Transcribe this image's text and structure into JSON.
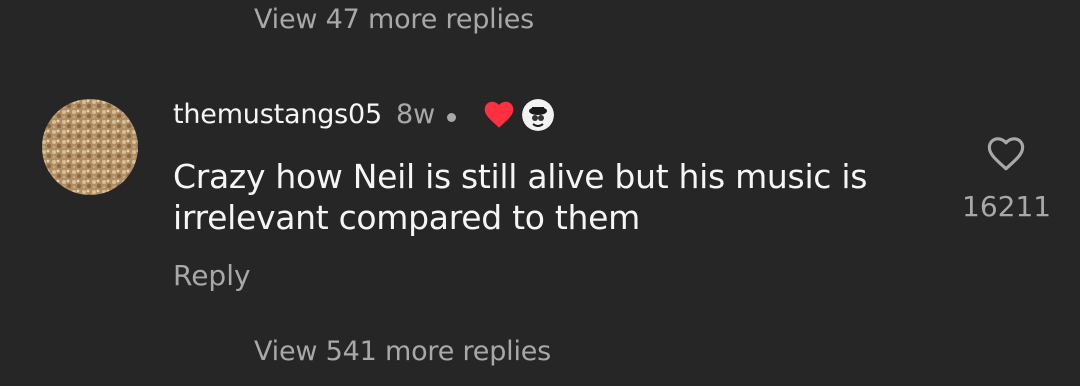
{
  "replies_top": {
    "label": "View 47 more replies"
  },
  "comment": {
    "username": "themustangs05",
    "time": "8w",
    "text": "Crazy how Neil is still alive but his music is irrelevant compared to them",
    "reply_label": "Reply",
    "like_count": "16211",
    "creator_liked": true
  },
  "replies_bottom": {
    "label": "View 541 more replies"
  },
  "colors": {
    "background": "#262626",
    "primary_text": "#f5f5f5",
    "secondary_text": "#a8a8a8",
    "heart_red": "#ff3040"
  },
  "icons": {
    "like": "heart-outline-icon",
    "creator_like": "heart-filled-icon"
  }
}
